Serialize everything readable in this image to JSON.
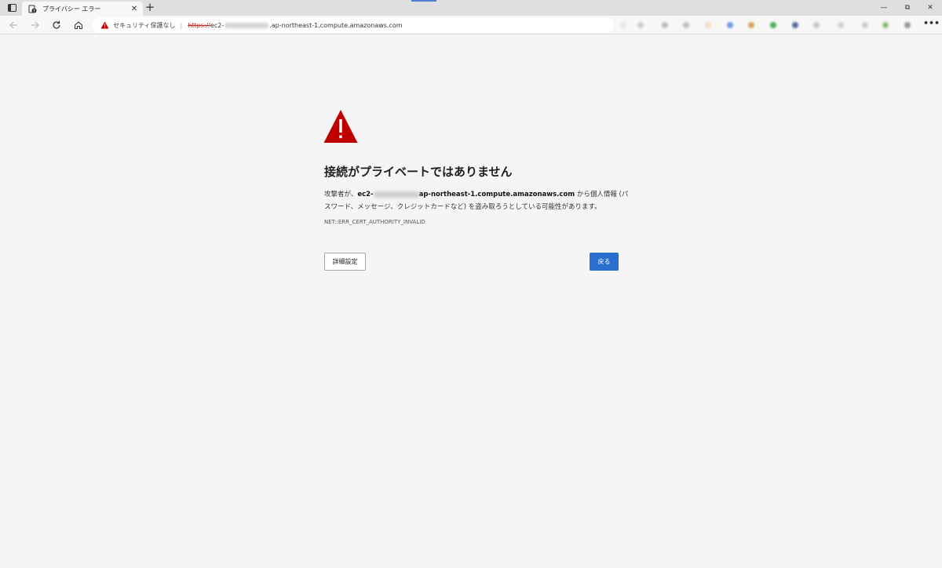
{
  "browser": {
    "tab": {
      "title": "プライバシー エラー",
      "close_label": "✕"
    },
    "new_tab_label": "+",
    "window_controls": {
      "minimize": "—",
      "maximize": "⧉",
      "close": "✕"
    },
    "address_bar": {
      "security_label": "セキュリティ保護なし",
      "separator": "|",
      "protocol": "https://",
      "host_prefix": "ec2-",
      "host_suffix": ".ap-northeast-1.compute.amazonaws.com"
    },
    "more_label": "•••",
    "icons": {
      "tab_actions": "tab-actions-icon",
      "favicon": "warning-page-icon",
      "back": "back-arrow-icon",
      "forward": "forward-arrow-icon",
      "refresh": "refresh-icon",
      "home": "home-icon",
      "not_secure": "warning-triangle-icon"
    }
  },
  "error_page": {
    "heading": "接続がプライベートではありません",
    "description": {
      "prefix": "攻撃者が、",
      "host_prefix": "ec2-",
      "host_suffix": "ap-northeast-1.compute.amazonaws.com",
      "suffix": " から個人情報 (パスワード、メッセージ、クレジットカードなど) を盗み取ろうとしている可能性があります。"
    },
    "error_code": "NET::ERR_CERT_AUTHORITY_INVALID",
    "advanced_button": "詳細設定",
    "back_button": "戻る"
  },
  "colors": {
    "warning_red": "#c00000",
    "back_button_blue": "#2a6ecf",
    "page_background": "#f5f5f5"
  }
}
